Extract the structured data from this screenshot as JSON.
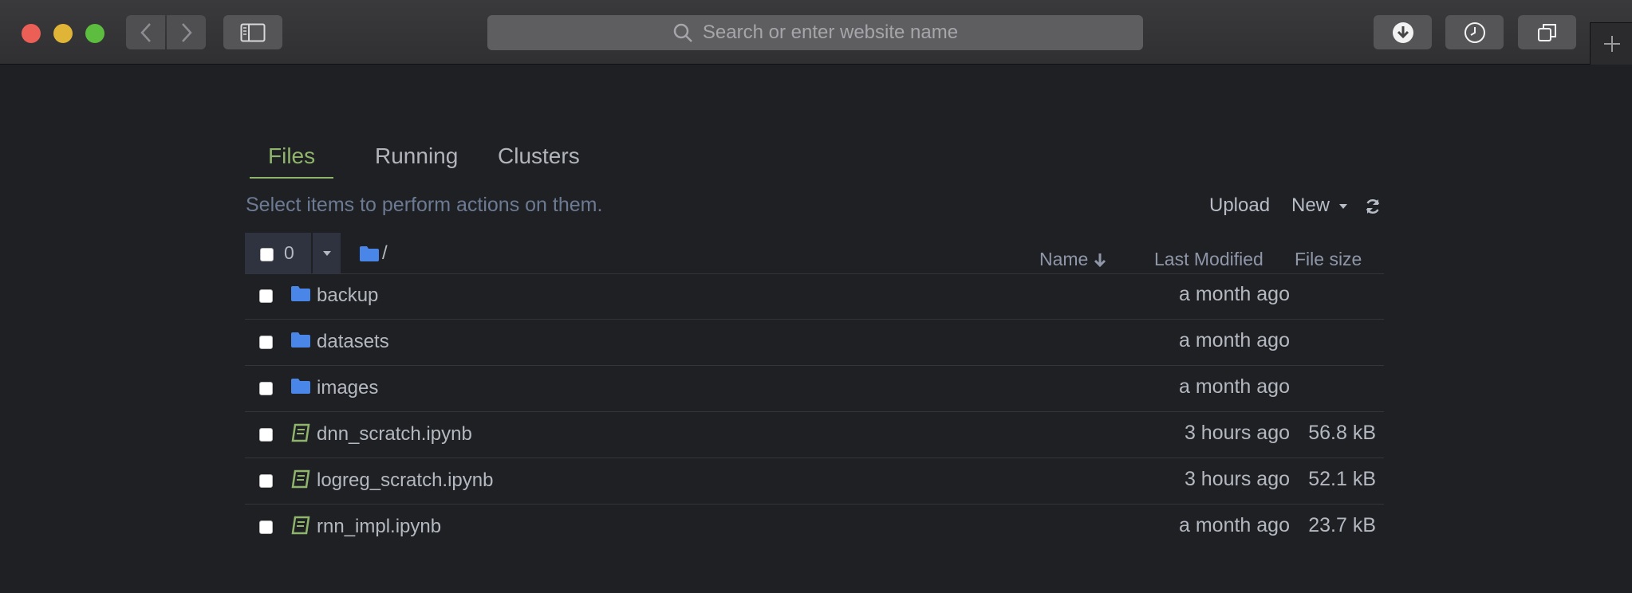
{
  "browser": {
    "address_placeholder": "Search or enter website name"
  },
  "tabs": [
    {
      "label": "Files",
      "active": true
    },
    {
      "label": "Running",
      "active": false
    },
    {
      "label": "Clusters",
      "active": false
    }
  ],
  "toolbar": {
    "hint": "Select items to perform actions on them.",
    "upload_label": "Upload",
    "new_label": "New"
  },
  "list_header": {
    "selected_count": "0",
    "breadcrumb": "/",
    "columns": {
      "name": "Name",
      "last_modified": "Last Modified",
      "file_size": "File size"
    }
  },
  "files": [
    {
      "name": "backup",
      "type": "folder",
      "modified": "a month ago",
      "size": ""
    },
    {
      "name": "datasets",
      "type": "folder",
      "modified": "a month ago",
      "size": ""
    },
    {
      "name": "images",
      "type": "folder",
      "modified": "a month ago",
      "size": ""
    },
    {
      "name": "dnn_scratch.ipynb",
      "type": "notebook",
      "modified": "3 hours ago",
      "size": "56.8 kB"
    },
    {
      "name": "logreg_scratch.ipynb",
      "type": "notebook",
      "modified": "3 hours ago",
      "size": "52.1 kB"
    },
    {
      "name": "rnn_impl.ipynb",
      "type": "notebook",
      "modified": "a month ago",
      "size": "23.7 kB"
    }
  ],
  "colors": {
    "accent_green": "#8fb46b",
    "folder_blue": "#4a86e8",
    "notebook_green": "#8fb46b"
  }
}
